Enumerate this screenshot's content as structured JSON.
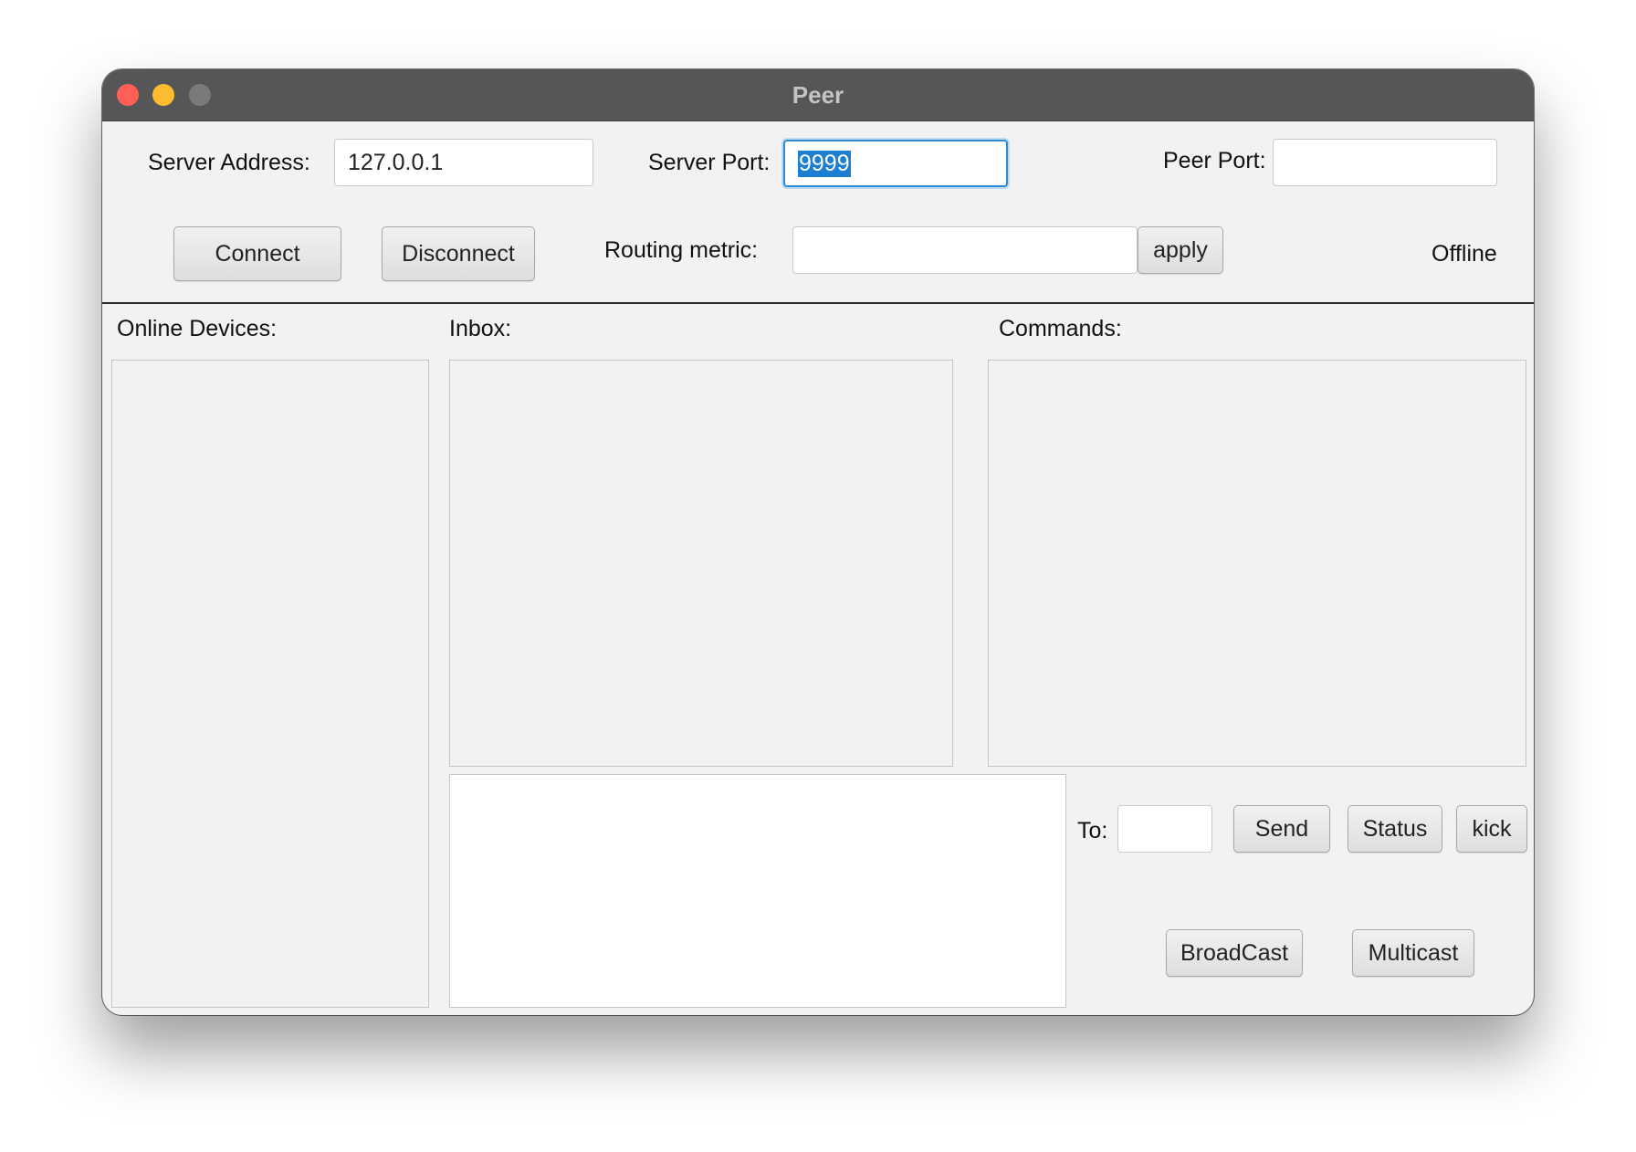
{
  "window": {
    "title": "Peer",
    "controls": [
      "close",
      "minimize",
      "maximize"
    ]
  },
  "connection": {
    "server_address_label": "Server Address:",
    "server_address_value": "127.0.0.1",
    "server_port_label": "Server Port:",
    "server_port_value": "9999",
    "peer_port_label": "Peer Port:",
    "peer_port_value": "",
    "connect_label": "Connect",
    "disconnect_label": "Disconnect",
    "routing_metric_label": "Routing metric:",
    "routing_metric_value": "",
    "apply_label": "apply",
    "status": "Offline"
  },
  "panels": {
    "online_devices_label": "Online Devices:",
    "inbox_label": "Inbox:",
    "commands_label": "Commands:"
  },
  "compose": {
    "message_value": "",
    "to_label": "To:",
    "to_value": "",
    "send_label": "Send",
    "status_label": "Status",
    "kick_label": "kick",
    "broadcast_label": "BroadCast",
    "multicast_label": "Multicast"
  }
}
